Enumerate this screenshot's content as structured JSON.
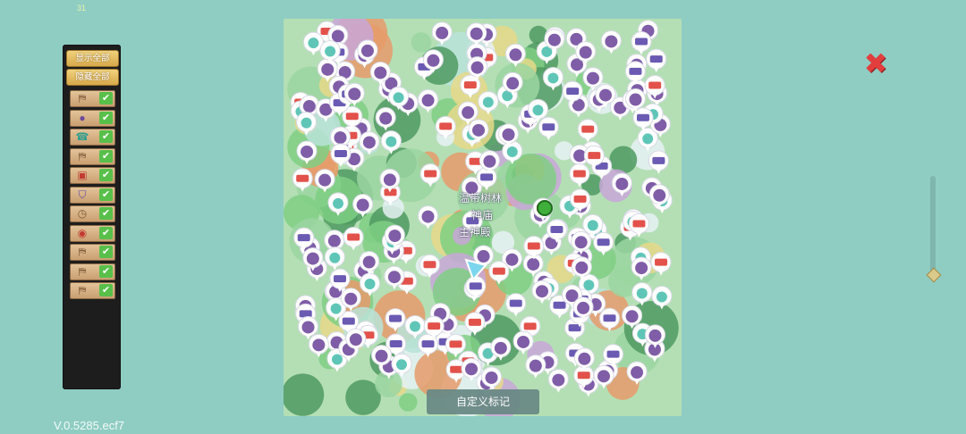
{
  "fps": "31",
  "version": "V.0.5285.ecf7",
  "panel": {
    "show_all": "显示全部",
    "hide_all": "隐藏全部",
    "filters": [
      {
        "icon": "signpost-icon",
        "glyph": "⛿",
        "checked": true
      },
      {
        "icon": "npc-hood-icon",
        "glyph": "●",
        "checked": true
      },
      {
        "icon": "teleport-icon",
        "glyph": "☎",
        "checked": true
      },
      {
        "icon": "signpost-icon",
        "glyph": "⛿",
        "checked": true
      },
      {
        "icon": "chest-red-icon",
        "glyph": "▣",
        "checked": true
      },
      {
        "icon": "sofa-icon",
        "glyph": "⛉",
        "checked": true
      },
      {
        "icon": "clock-icon",
        "glyph": "◷",
        "checked": true
      },
      {
        "icon": "snail-icon",
        "glyph": "◉",
        "checked": true
      },
      {
        "icon": "signpost-icon",
        "glyph": "⛿",
        "checked": true
      },
      {
        "icon": "signpost-icon",
        "glyph": "⛿",
        "checked": true
      },
      {
        "icon": "signpost-icon",
        "glyph": "⛿",
        "checked": true
      }
    ]
  },
  "map": {
    "labels": [
      "温带树林",
      "神庙",
      "主神殿"
    ],
    "custom_marker_label": "自定义标记",
    "colors": {
      "water": "#b8e3d8",
      "grass": "#7fcf84",
      "dark_grass": "#4f9a61",
      "sand": "#e6d98a",
      "snow": "#e6f2f4",
      "hood": "#7f5da7",
      "chest": "#e2524b",
      "sofa": "#6a5ab2",
      "teleport": "#5fc6b7"
    }
  },
  "close_label": "✖"
}
